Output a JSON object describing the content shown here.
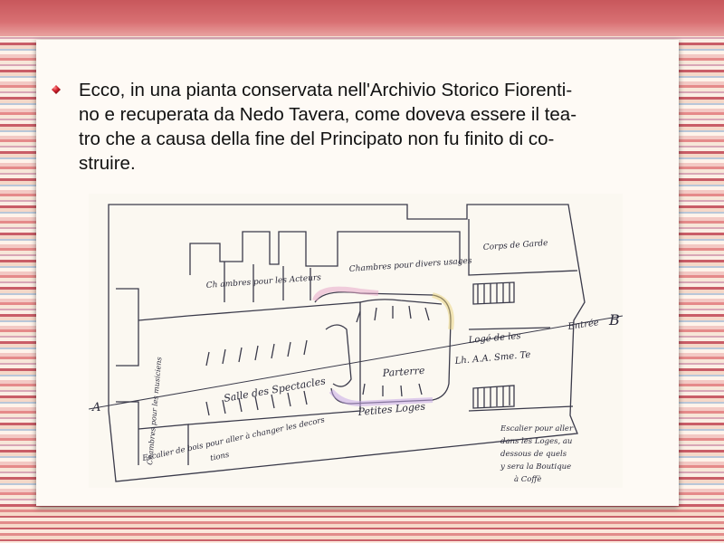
{
  "slide": {
    "bullet_text": "Ecco, in una pianta conservata nell'Archivio Storico Fiorenti-\nno e recuperata da Nedo Tavera, come doveva essere il tea-\ntro che a causa della fine del Principato non fu finito di co-\nstruire."
  },
  "floor_plan": {
    "labels": {
      "chambres": "Ch ambres pour les Acteurs",
      "chambres_divers": "Chambres pour divers usages",
      "corps_garde": "Corps de Garde",
      "chambres_musiciens": "Chambres pour les musiciens",
      "salle": "Salle des Spectacles",
      "parterre": "Parterre",
      "petites_loges": "Petites Loges",
      "loge_line1": "Logé de les",
      "loge_line2": "Lh. A.A. Sme. Te",
      "entree": "Entrée",
      "mark_a": "A",
      "mark_b": "B",
      "escalier_bois": "Escalier de bois pour aller à changer les decors",
      "escalier_bois_sub": "tions",
      "escalier_loges_1": "Escalier pour aller",
      "escalier_loges_2": "dans les Loges, au",
      "escalier_loges_3": "dessous de quels",
      "escalier_loges_4": "y sera la Boutique",
      "escalier_loges_5": "à Coffè"
    }
  },
  "colors": {
    "bullet": "#c0242f",
    "slide_background": "#fefaf5",
    "ink": "#2a2a3a"
  }
}
